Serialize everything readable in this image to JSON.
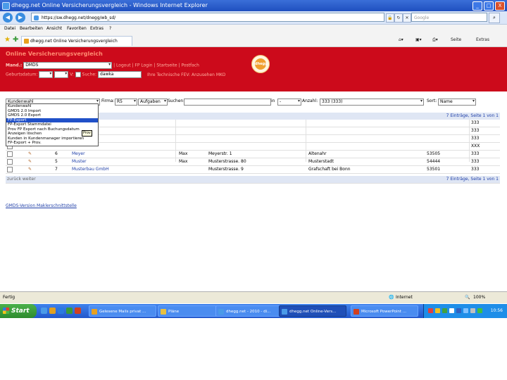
{
  "window": {
    "title": "dhegg.net Online Versicherungsvergleich - Windows Internet Explorer",
    "url": "https://sw.dhegg.net/dnegg/wb_sd/",
    "search_placeholder": "Google",
    "controls": [
      "_",
      "□",
      "X"
    ]
  },
  "menu": [
    "Datei",
    "Bearbeiten",
    "Ansicht",
    "Favoriten",
    "Extras",
    "?"
  ],
  "tab": {
    "label": "dhegg.net Online Versicherungsvergleich"
  },
  "toolbar_right": [
    "Seite",
    "Extras"
  ],
  "app": {
    "heading": "Online Versicherungsvergleich",
    "mand_label": "Mand.:",
    "mand_value": "DMDS",
    "links": "| Logout | FP Login | Startseite | Postfach",
    "geburtsdatum_label": "Geburtsdatum:",
    "v_label": "V:",
    "suche_label": "Suche:",
    "suche_value": "dawka",
    "hint": "Ihre Technische FEV: Anzusehen MKO",
    "logo_text": "dhegg"
  },
  "filter": {
    "select_value": "Kundenwahl",
    "firma_label": "Firma:",
    "firma_value": "R5",
    "status_value": "Aufgaben",
    "suchen_label": "Suchen:",
    "in_label": "in",
    "in_value": "-",
    "anzahl_label": "Anzahl:",
    "anzahl_value": "333 (333)",
    "sort_label": "Sort:",
    "sort_value": "Name"
  },
  "dropdown": {
    "items": [
      "Kundenwahl",
      "GMDS 2.0 Import",
      "GMDS 2.0 Export",
      "FP-Export",
      "FP-Export Stammdatei",
      "Prov FP Export nach Buchungsdatum",
      "Anzeigen löschen",
      "Kunden in Kundenmanager importieren",
      "FP-Export + Prov."
    ],
    "selected_index": 3,
    "tooltip": "Prov"
  },
  "pager": {
    "top": "7 Einträge, Seite 1 von 1",
    "bottom": "7 Einträge, Seite 1 von 1"
  },
  "rows": [
    {
      "nr": "",
      "name": "",
      "vorname": "",
      "strasse": "",
      "ort": "",
      "plz": "",
      "val": "333"
    },
    {
      "nr": "",
      "name": "",
      "vorname": "",
      "strasse": "",
      "ort": "",
      "plz": "",
      "val": "333"
    },
    {
      "nr": "",
      "name": "",
      "vorname": "",
      "strasse": "",
      "ort": "",
      "plz": "",
      "val": "333"
    },
    {
      "nr": "",
      "name": "",
      "vorname": "",
      "strasse": "",
      "ort": "",
      "plz": "",
      "val": "XXX"
    },
    {
      "nr": "6",
      "name": "Meyer",
      "vorname": "Max",
      "strasse": "Meyerstr. 1",
      "ort": "Altenahr",
      "plz": "53505",
      "val": "333"
    },
    {
      "nr": "5",
      "name": "Muster",
      "vorname": "Max",
      "strasse": "Musterstrasse. 80",
      "ort": "Musterstadt",
      "plz": "54444",
      "val": "333"
    },
    {
      "nr": "7",
      "name": "Musterbau GmbH",
      "vorname": "",
      "strasse": "Musterstrasse. 9",
      "ort": "Grafschaft bei Bonn",
      "plz": "53501",
      "val": "333"
    }
  ],
  "zurueck": "zurück  weiter",
  "footer_link": "GMDS-Version Maklerschnittstelle",
  "status": {
    "left": "Fertig",
    "zone": "Internet",
    "zoom": "100%"
  },
  "taskbar": {
    "start": "Start",
    "items": [
      "Gelesene Mails privat ...",
      "Pläne",
      "dhegg.net - 2010 - di...",
      "dhegg.net Online-Vers...",
      "Microsoft PowerPoint ..."
    ],
    "active_index": 3,
    "clock": "10:56"
  }
}
